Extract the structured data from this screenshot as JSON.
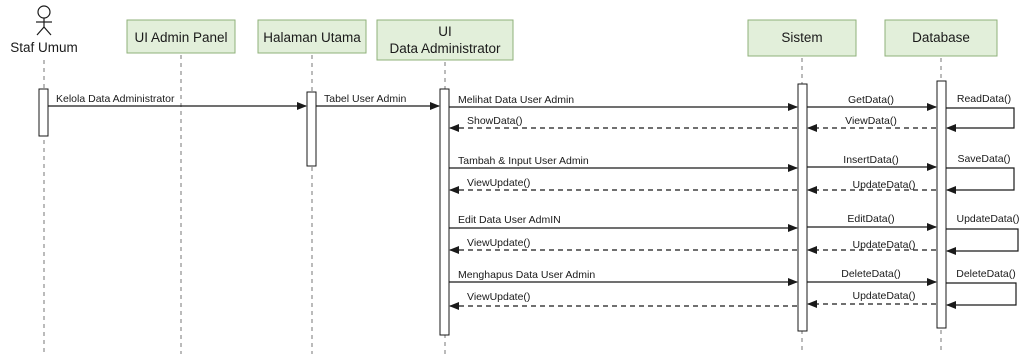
{
  "actor": {
    "label": "Staf Umum",
    "icon": "stick-figure-actor-icon"
  },
  "participants": [
    {
      "id": "admin_panel",
      "label": "UI Admin Panel"
    },
    {
      "id": "halaman_utama",
      "label": "Halaman Utama"
    },
    {
      "id": "ui_data_admin",
      "label_line1": "UI",
      "label_line2": "Data Administrator"
    },
    {
      "id": "sistem",
      "label": "Sistem"
    },
    {
      "id": "database",
      "label": "Database"
    }
  ],
  "messages": [
    {
      "from": "actor",
      "to": "halaman_utama",
      "label": "Kelola Data Administrator",
      "type": "sync"
    },
    {
      "from": "halaman_utama",
      "to": "ui_data_admin",
      "label": "Tabel User Admin",
      "type": "sync"
    },
    {
      "from": "ui_data_admin",
      "to": "sistem",
      "label": "Melihat Data User Admin",
      "type": "sync"
    },
    {
      "from": "sistem",
      "to": "ui_data_admin",
      "label": "ShowData()",
      "type": "return"
    },
    {
      "from": "sistem",
      "to": "database",
      "label": "GetData()",
      "type": "sync"
    },
    {
      "from": "database",
      "to": "sistem",
      "label": "ViewData()",
      "type": "return"
    },
    {
      "from": "database",
      "to": "database",
      "label": "ReadData()",
      "type": "self"
    },
    {
      "from": "ui_data_admin",
      "to": "sistem",
      "label": "Tambah & Input User Admin",
      "type": "sync"
    },
    {
      "from": "sistem",
      "to": "ui_data_admin",
      "label": "ViewUpdate()",
      "type": "return"
    },
    {
      "from": "sistem",
      "to": "database",
      "label": "InsertData()",
      "type": "sync"
    },
    {
      "from": "database",
      "to": "sistem",
      "label": "UpdateData()",
      "type": "return"
    },
    {
      "from": "database",
      "to": "database",
      "label": "SaveData()",
      "type": "self"
    },
    {
      "from": "ui_data_admin",
      "to": "sistem",
      "label": "Edit Data User AdmIN",
      "type": "sync"
    },
    {
      "from": "sistem",
      "to": "ui_data_admin",
      "label": "ViewUpdate()",
      "type": "return"
    },
    {
      "from": "sistem",
      "to": "database",
      "label": "EditData()",
      "type": "sync"
    },
    {
      "from": "database",
      "to": "sistem",
      "label": "UpdateData()",
      "type": "return"
    },
    {
      "from": "database",
      "to": "database",
      "label": "UpdateData()",
      "type": "self"
    },
    {
      "from": "ui_data_admin",
      "to": "sistem",
      "label": "Menghapus Data User Admin",
      "type": "sync"
    },
    {
      "from": "sistem",
      "to": "ui_data_admin",
      "label": "ViewUpdate()",
      "type": "return"
    },
    {
      "from": "sistem",
      "to": "database",
      "label": "DeleteData()",
      "type": "sync"
    },
    {
      "from": "database",
      "to": "sistem",
      "label": "UpdateData()",
      "type": "return"
    },
    {
      "from": "database",
      "to": "database",
      "label": "DeleteData()",
      "type": "self"
    }
  ],
  "colors": {
    "header_fill": "#e2efda",
    "header_stroke": "#8fb07a",
    "lifeline": "#777777",
    "arrow": "#1a1a1a"
  }
}
